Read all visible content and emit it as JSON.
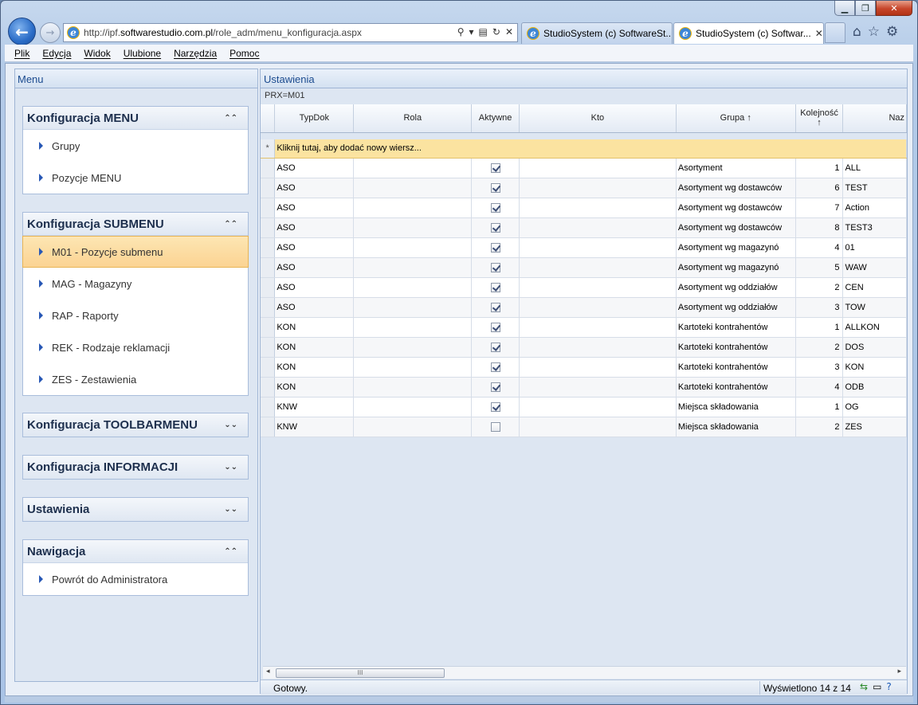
{
  "browser": {
    "url_prefix": "http://ipf.",
    "url_domain": "softwarestudio.com.pl",
    "url_path": "/role_adm/menu_konfiguracja.aspx",
    "tabs": [
      {
        "label": "StudioSystem (c) SoftwareSt..."
      },
      {
        "label": "StudioSystem (c) Softwar..."
      }
    ],
    "menu": [
      "Plik",
      "Edycja",
      "Widok",
      "Ulubione",
      "Narzędzia",
      "Pomoc"
    ]
  },
  "left_pane": {
    "title": "Menu",
    "groups": [
      {
        "title": "Konfiguracja MENU",
        "items": [
          "Grupy",
          "Pozycje MENU"
        ]
      },
      {
        "title": "Konfiguracja SUBMENU",
        "items": [
          "M01 - Pozycje submenu",
          "MAG - Magazyny",
          "RAP - Raporty",
          "REK - Rodzaje reklamacji",
          "ZES - Zestawienia"
        ]
      },
      {
        "title": "Konfiguracja TOOLBARMENU",
        "items": []
      },
      {
        "title": "Konfiguracja INFORMACJI",
        "items": []
      },
      {
        "title": "Ustawienia",
        "items": []
      },
      {
        "title": "Nawigacja",
        "items": [
          "Powrót do Administratora"
        ]
      }
    ]
  },
  "right_pane": {
    "title": "Ustawienia",
    "filter": "PRX=M01",
    "columns": {
      "typdok": "TypDok",
      "rola": "Rola",
      "aktywne": "Aktywne",
      "kto": "Kto",
      "grupa": "Grupa",
      "kolejnosc": "Kolejność",
      "nazwa": "Naz"
    },
    "new_row_text": "Kliknij tutaj, aby dodać nowy wiersz...",
    "new_row_marker": "*",
    "rows": [
      {
        "typdok": "ASO",
        "rola": "",
        "aktywne": true,
        "kto": "",
        "grupa": "Asortyment",
        "kolejnosc": "1",
        "nazwa": "ALL"
      },
      {
        "typdok": "ASO",
        "rola": "",
        "aktywne": true,
        "kto": "",
        "grupa": "Asortyment wg dostawców",
        "kolejnosc": "6",
        "nazwa": "TEST"
      },
      {
        "typdok": "ASO",
        "rola": "",
        "aktywne": true,
        "kto": "",
        "grupa": "Asortyment wg dostawców",
        "kolejnosc": "7",
        "nazwa": "Action"
      },
      {
        "typdok": "ASO",
        "rola": "",
        "aktywne": true,
        "kto": "",
        "grupa": "Asortyment wg dostawców",
        "kolejnosc": "8",
        "nazwa": "TEST3"
      },
      {
        "typdok": "ASO",
        "rola": "",
        "aktywne": true,
        "kto": "",
        "grupa": "Asortyment wg magazynó",
        "kolejnosc": "4",
        "nazwa": "01"
      },
      {
        "typdok": "ASO",
        "rola": "",
        "aktywne": true,
        "kto": "",
        "grupa": "Asortyment wg magazynó",
        "kolejnosc": "5",
        "nazwa": "WAW"
      },
      {
        "typdok": "ASO",
        "rola": "",
        "aktywne": true,
        "kto": "",
        "grupa": "Asortyment wg oddziałów",
        "kolejnosc": "2",
        "nazwa": "CEN"
      },
      {
        "typdok": "ASO",
        "rola": "",
        "aktywne": true,
        "kto": "",
        "grupa": "Asortyment wg oddziałów",
        "kolejnosc": "3",
        "nazwa": "TOW"
      },
      {
        "typdok": "KON",
        "rola": "",
        "aktywne": true,
        "kto": "",
        "grupa": "Kartoteki kontrahentów",
        "kolejnosc": "1",
        "nazwa": "ALLKON"
      },
      {
        "typdok": "KON",
        "rola": "",
        "aktywne": true,
        "kto": "",
        "grupa": "Kartoteki kontrahentów",
        "kolejnosc": "2",
        "nazwa": "DOS"
      },
      {
        "typdok": "KON",
        "rola": "",
        "aktywne": true,
        "kto": "",
        "grupa": "Kartoteki kontrahentów",
        "kolejnosc": "3",
        "nazwa": "KON"
      },
      {
        "typdok": "KON",
        "rola": "",
        "aktywne": true,
        "kto": "",
        "grupa": "Kartoteki kontrahentów",
        "kolejnosc": "4",
        "nazwa": "ODB"
      },
      {
        "typdok": "KNW",
        "rola": "",
        "aktywne": true,
        "kto": "",
        "grupa": "Miejsca składowania",
        "kolejnosc": "1",
        "nazwa": "OG"
      },
      {
        "typdok": "KNW",
        "rola": "",
        "aktywne": false,
        "kto": "",
        "grupa": "Miejsca składowania",
        "kolejnosc": "2",
        "nazwa": "ZES"
      }
    ],
    "scroll_thumb_grip": "III",
    "status": {
      "left": "Gotowy.",
      "count": "Wyświetlono 14 z 14"
    }
  }
}
